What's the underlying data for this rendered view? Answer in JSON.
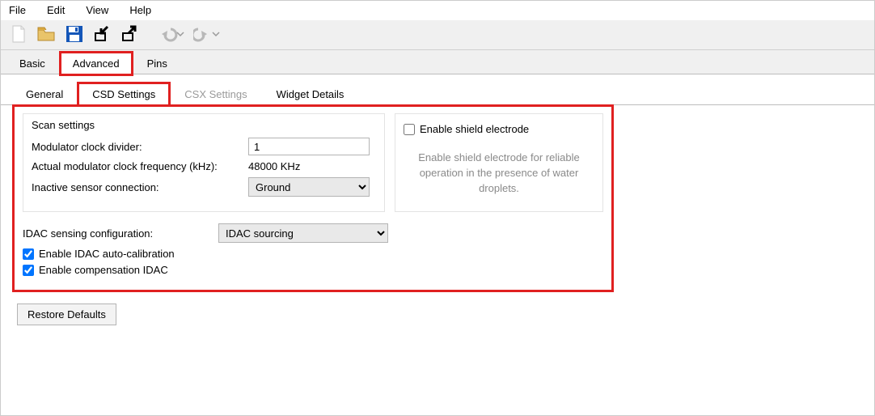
{
  "menu": {
    "file": "File",
    "edit": "Edit",
    "view": "View",
    "help": "Help"
  },
  "primary_tabs": {
    "basic": "Basic",
    "advanced": "Advanced",
    "pins": "Pins",
    "active": "advanced"
  },
  "sub_tabs": {
    "general": "General",
    "csd": "CSD Settings",
    "csx": "CSX Settings",
    "widget": "Widget Details",
    "active": "csd"
  },
  "scan": {
    "legend": "Scan settings",
    "mod_divider_label": "Modulator clock divider:",
    "mod_divider_value": "1",
    "actual_freq_label": "Actual modulator clock frequency (kHz):",
    "actual_freq_value": "48000 KHz",
    "inactive_label": "Inactive sensor connection:",
    "inactive_value": "Ground"
  },
  "shield": {
    "enable_label": "Enable shield electrode",
    "enable_checked": false,
    "description": "Enable shield electrode for reliable operation in the presence of water droplets."
  },
  "idac": {
    "config_label": "IDAC sensing configuration:",
    "config_value": "IDAC sourcing",
    "auto_cal_label": "Enable IDAC auto-calibration",
    "auto_cal_checked": true,
    "comp_label": "Enable compensation IDAC",
    "comp_checked": true
  },
  "buttons": {
    "restore": "Restore Defaults"
  }
}
